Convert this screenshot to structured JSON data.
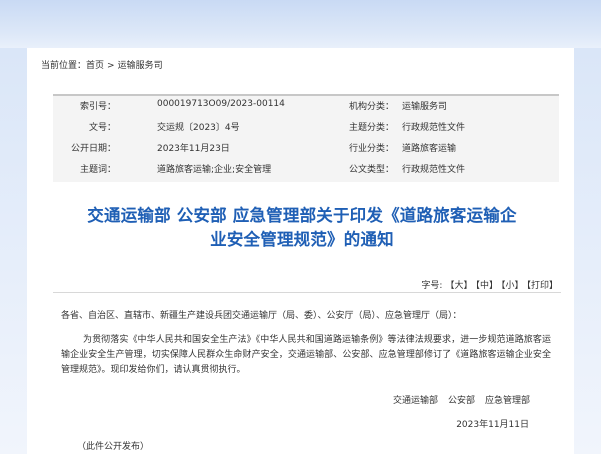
{
  "breadcrumb": {
    "prefix": "当前位置：",
    "home": "首页",
    "separator": ">",
    "section": "运输服务司"
  },
  "meta": {
    "index_label": "索引号：",
    "index_value": "000019713O09/2023-00114",
    "org_label": "机构分类：",
    "org_value": "运输服务司",
    "docno_label": "文号：",
    "docno_value": "交运规〔2023〕4号",
    "topic_label": "主题分类：",
    "topic_value": "行政规范性文件",
    "pubdate_label": "公开日期：",
    "pubdate_value": "2023年11月23日",
    "industry_label": "行业分类：",
    "industry_value": "道路旅客运输",
    "keywords_label": "主题词：",
    "keywords_value": "道路旅客运输;企业;安全管理",
    "doctype_label": "公文类型：",
    "doctype_value": "行政规范性文件"
  },
  "title": {
    "line1": "交通运输部 公安部 应急管理部关于印发《道路旅客运输企",
    "line2": "业安全管理规范》的通知"
  },
  "fontsize": {
    "label": "字号:",
    "large": "【大】",
    "medium": "【中】",
    "small": "【小】",
    "print": "【打印】"
  },
  "content": {
    "salutation": "各省、自治区、直辖市、新疆生产建设兵团交通运输厅（局、委）、公安厅（局）、应急管理厅（局）：",
    "main": "为贯彻落实《中华人民共和国安全生产法》《中华人民共和国道路运输条例》等法律法规要求，进一步规范道路旅客运输企业安全生产管理，切实保障人民群众生命财产安全，交通运输部、公安部、应急管理部修订了《道路旅客运输企业安全管理规范》。现印发给你们，请认真贯彻执行。",
    "signers": [
      "交通运输部",
      "公安部",
      "应急管理部"
    ],
    "date": "2023年11月11日",
    "note": "（此件公开发布）"
  }
}
